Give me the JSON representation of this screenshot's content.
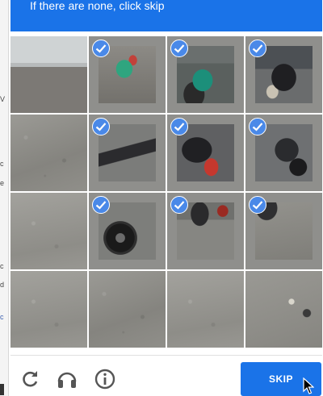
{
  "background_page": {
    "fragments": [
      {
        "text": "V",
        "color": "dark"
      },
      {
        "text": "c",
        "color": "dark"
      },
      {
        "text": "e",
        "color": "dark"
      },
      {
        "text": "c",
        "color": "dark"
      },
      {
        "text": "d",
        "color": "dark"
      },
      {
        "text": "c",
        "color": "blue"
      }
    ]
  },
  "challenge": {
    "instruction": "If there are none, click skip",
    "accent_color": "#1a73e8",
    "tiles": [
      {
        "row": 1,
        "col": 1,
        "selected": false,
        "content": "storefront-sidewalk"
      },
      {
        "row": 1,
        "col": 2,
        "selected": true,
        "content": "green-chair"
      },
      {
        "row": 1,
        "col": 3,
        "selected": true,
        "content": "teal-motorcycle"
      },
      {
        "row": 1,
        "col": 4,
        "selected": true,
        "content": "parked-motorcycles"
      },
      {
        "row": 2,
        "col": 1,
        "selected": false,
        "content": "pavement"
      },
      {
        "row": 2,
        "col": 2,
        "selected": true,
        "content": "motorcycle-side"
      },
      {
        "row": 2,
        "col": 3,
        "selected": true,
        "content": "motorcycle-red-light"
      },
      {
        "row": 2,
        "col": 4,
        "selected": true,
        "content": "motorcycle-rear"
      },
      {
        "row": 3,
        "col": 1,
        "selected": false,
        "content": "pavement"
      },
      {
        "row": 3,
        "col": 2,
        "selected": true,
        "content": "motorcycle-wheel"
      },
      {
        "row": 3,
        "col": 3,
        "selected": true,
        "content": "motorcycle-lower"
      },
      {
        "row": 3,
        "col": 4,
        "selected": true,
        "content": "pavement-shadow"
      },
      {
        "row": 4,
        "col": 1,
        "selected": false,
        "content": "pavement"
      },
      {
        "row": 4,
        "col": 2,
        "selected": false,
        "content": "pavement"
      },
      {
        "row": 4,
        "col": 3,
        "selected": false,
        "content": "pavement"
      },
      {
        "row": 4,
        "col": 4,
        "selected": false,
        "content": "pavement-debris"
      }
    ]
  },
  "footer": {
    "icons": [
      "reload-icon",
      "audio-headphones-icon",
      "info-icon"
    ],
    "skip_label": "SKIP"
  }
}
